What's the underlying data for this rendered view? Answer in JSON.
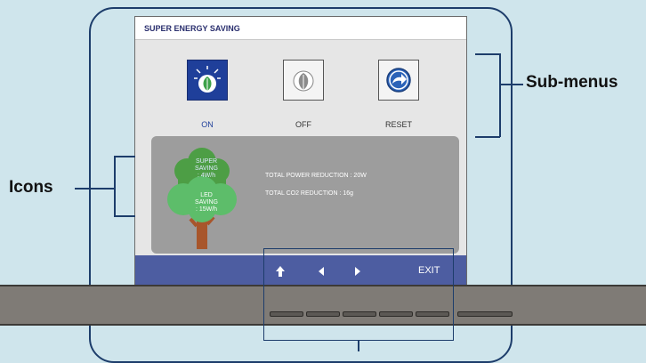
{
  "osd": {
    "title": "SUPER ENERGY SAVING",
    "submenus": [
      {
        "label": "ON",
        "icon": "leaf-icon",
        "selected": true
      },
      {
        "label": "OFF",
        "icon": "leaf-off-icon",
        "selected": false
      },
      {
        "label": "RESET",
        "icon": "reset-arrow-icon",
        "selected": false
      }
    ],
    "tree": {
      "super_saving": [
        "SUPER",
        "SAVING",
        ": 4W/h"
      ],
      "led_saving": [
        "LED",
        "SAVING",
        ": 15W/h"
      ]
    },
    "stats": {
      "power": "TOTAL POWER REDUCTION : 20W",
      "co2": "TOTAL CO2 REDUCTION : 16g"
    },
    "nav": {
      "icons": [
        "up-arrow-icon",
        "left-arrow-icon",
        "right-arrow-icon"
      ],
      "exit_label": "EXIT"
    }
  },
  "annotations": {
    "left_label": "Icons",
    "right_label": "Sub-menus"
  },
  "colors": {
    "background": "#cfe5ec",
    "selected_tile": "#1f3f9a",
    "nav_bar": "#4d5da1",
    "tree_top": "#4d9e45",
    "tree_bottom": "#5dbd6a"
  }
}
